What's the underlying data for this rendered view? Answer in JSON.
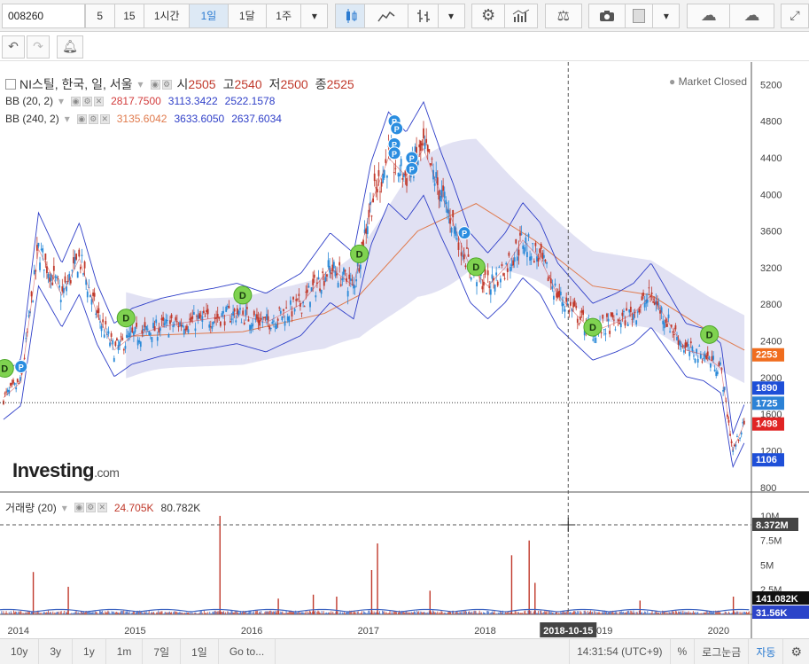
{
  "toolbar": {
    "symbol": "008260",
    "intervals": [
      "5",
      "15",
      "1시간",
      "1일",
      "1달",
      "1주"
    ],
    "active_interval": "1일"
  },
  "legend": {
    "title": "NI스틸, 한국, 일, 서울",
    "open_label": "시",
    "open": "2505",
    "high_label": "고",
    "high": "2540",
    "low_label": "저",
    "low": "2500",
    "close_label": "종",
    "close": "2525",
    "bb1_label": "BB (20, 2)",
    "bb1_v1": "2817.7500",
    "bb1_v2": "3113.3422",
    "bb1_v3": "2522.1578",
    "bb2_label": "BB (240, 2)",
    "bb2_v1": "3135.6042",
    "bb2_v2": "3633.6050",
    "bb2_v3": "2637.6034",
    "vol_label": "거래량 (20)",
    "vol_v1": "24.705K",
    "vol_v2": "80.782K"
  },
  "status": "Market Closed",
  "logo": {
    "main": "Investing",
    "suffix": ".com"
  },
  "crosshair": {
    "date": "2018-10-15",
    "volume": "8.372M"
  },
  "bottom": {
    "ranges": [
      "10y",
      "3y",
      "1y",
      "1m",
      "7일",
      "1일",
      "Go to..."
    ],
    "time": "14:31:54 (UTC+9)",
    "percent": "%",
    "log": "로그눈금",
    "auto": "자동"
  },
  "colors": {
    "up": "#2b8ad8",
    "down": "#c0392b",
    "band": "#c9c9ea",
    "band_line": "#2f3fc8",
    "ma240": "#e07a4c"
  },
  "chart_data": {
    "type": "candlestick",
    "x_axis": {
      "ticks": [
        "2014",
        "2015",
        "2016",
        "2017",
        "2018",
        "2019",
        "2020"
      ]
    },
    "y_axis": {
      "ticks": [
        800,
        1200,
        1600,
        2000,
        2400,
        2800,
        3200,
        3600,
        4000,
        4400,
        4800,
        5200
      ],
      "ylim": [
        750,
        5300
      ]
    },
    "price_tags": [
      {
        "value": 2253,
        "color": "#f06d1e"
      },
      {
        "value": 1890,
        "color": "#1e4fd8"
      },
      {
        "value": 1725,
        "color": "#2c82d6"
      },
      {
        "value": 1498,
        "color": "#e02424"
      },
      {
        "value": 1106,
        "color": "#1e4fd8"
      }
    ],
    "close_series": [
      {
        "x": 2013.95,
        "y": 1780
      },
      {
        "x": 2014.1,
        "y": 1950
      },
      {
        "x": 2014.25,
        "y": 3400
      },
      {
        "x": 2014.45,
        "y": 2900
      },
      {
        "x": 2014.6,
        "y": 3300
      },
      {
        "x": 2014.75,
        "y": 2700
      },
      {
        "x": 2014.9,
        "y": 2300
      },
      {
        "x": 2015.05,
        "y": 2450
      },
      {
        "x": 2015.3,
        "y": 2550
      },
      {
        "x": 2015.5,
        "y": 2600
      },
      {
        "x": 2015.75,
        "y": 2650
      },
      {
        "x": 2015.95,
        "y": 2700
      },
      {
        "x": 2016.2,
        "y": 2600
      },
      {
        "x": 2016.5,
        "y": 2800
      },
      {
        "x": 2016.75,
        "y": 3200
      },
      {
        "x": 2016.95,
        "y": 3000
      },
      {
        "x": 2017.1,
        "y": 3900
      },
      {
        "x": 2017.25,
        "y": 4400
      },
      {
        "x": 2017.4,
        "y": 4200
      },
      {
        "x": 2017.55,
        "y": 4500
      },
      {
        "x": 2017.7,
        "y": 4000
      },
      {
        "x": 2017.8,
        "y": 3700
      },
      {
        "x": 2017.95,
        "y": 3200
      },
      {
        "x": 2018.1,
        "y": 3000
      },
      {
        "x": 2018.25,
        "y": 3200
      },
      {
        "x": 2018.4,
        "y": 3500
      },
      {
        "x": 2018.55,
        "y": 3300
      },
      {
        "x": 2018.7,
        "y": 2900
      },
      {
        "x": 2018.85,
        "y": 2700
      },
      {
        "x": 2019.0,
        "y": 2500
      },
      {
        "x": 2019.2,
        "y": 2600
      },
      {
        "x": 2019.35,
        "y": 2700
      },
      {
        "x": 2019.5,
        "y": 2900
      },
      {
        "x": 2019.65,
        "y": 2600
      },
      {
        "x": 2019.8,
        "y": 2300
      },
      {
        "x": 2019.95,
        "y": 2250
      },
      {
        "x": 2020.1,
        "y": 2100
      },
      {
        "x": 2020.2,
        "y": 1200
      },
      {
        "x": 2020.3,
        "y": 1500
      }
    ],
    "ma240": [
      {
        "x": 2015.0,
        "y": 2450
      },
      {
        "x": 2016.0,
        "y": 2500
      },
      {
        "x": 2016.7,
        "y": 2700
      },
      {
        "x": 2017.0,
        "y": 2900
      },
      {
        "x": 2017.5,
        "y": 3600
      },
      {
        "x": 2018.0,
        "y": 3900
      },
      {
        "x": 2018.5,
        "y": 3500
      },
      {
        "x": 2019.0,
        "y": 3000
      },
      {
        "x": 2019.5,
        "y": 2900
      },
      {
        "x": 2020.0,
        "y": 2500
      },
      {
        "x": 2020.3,
        "y": 2300
      }
    ],
    "markers": [
      {
        "label": "D",
        "x": 2013.96,
        "y": 2100
      },
      {
        "label": "P",
        "x": 2014.1,
        "y": 2120
      },
      {
        "label": "D",
        "x": 2015.0,
        "y": 2650
      },
      {
        "label": "D",
        "x": 2016.0,
        "y": 2900
      },
      {
        "label": "D",
        "x": 2017.0,
        "y": 3350
      },
      {
        "label": "P",
        "x": 2017.3,
        "y": 4800
      },
      {
        "label": "P",
        "x": 2017.32,
        "y": 4720
      },
      {
        "label": "P",
        "x": 2017.3,
        "y": 4550
      },
      {
        "label": "P",
        "x": 2017.3,
        "y": 4450
      },
      {
        "label": "P",
        "x": 2017.45,
        "y": 4400
      },
      {
        "label": "P",
        "x": 2017.45,
        "y": 4280
      },
      {
        "label": "P",
        "x": 2017.9,
        "y": 3580
      },
      {
        "label": "D",
        "x": 2018.0,
        "y": 3210
      },
      {
        "label": "D",
        "x": 2019.0,
        "y": 2550
      },
      {
        "label": "D",
        "x": 2020.0,
        "y": 2470
      }
    ],
    "volume": {
      "y_ticks": [
        "10M",
        "7.5M",
        "5M",
        "2.5M"
      ],
      "y_values": [
        10,
        7.5,
        5,
        2.5
      ],
      "tags": [
        "141.082K",
        "31.56K"
      ],
      "spikes": [
        {
          "x": 2014.2,
          "v": 4.3
        },
        {
          "x": 2014.5,
          "v": 2.8
        },
        {
          "x": 2015.8,
          "v": 10.0
        },
        {
          "x": 2016.3,
          "v": 1.6
        },
        {
          "x": 2016.6,
          "v": 2.0
        },
        {
          "x": 2016.8,
          "v": 1.8
        },
        {
          "x": 2017.1,
          "v": 4.5
        },
        {
          "x": 2017.15,
          "v": 7.2
        },
        {
          "x": 2017.6,
          "v": 2.4
        },
        {
          "x": 2018.3,
          "v": 6.0
        },
        {
          "x": 2018.45,
          "v": 7.5
        },
        {
          "x": 2018.5,
          "v": 3.2
        },
        {
          "x": 2019.4,
          "v": 1.4
        },
        {
          "x": 2020.2,
          "v": 1.8
        }
      ]
    }
  }
}
